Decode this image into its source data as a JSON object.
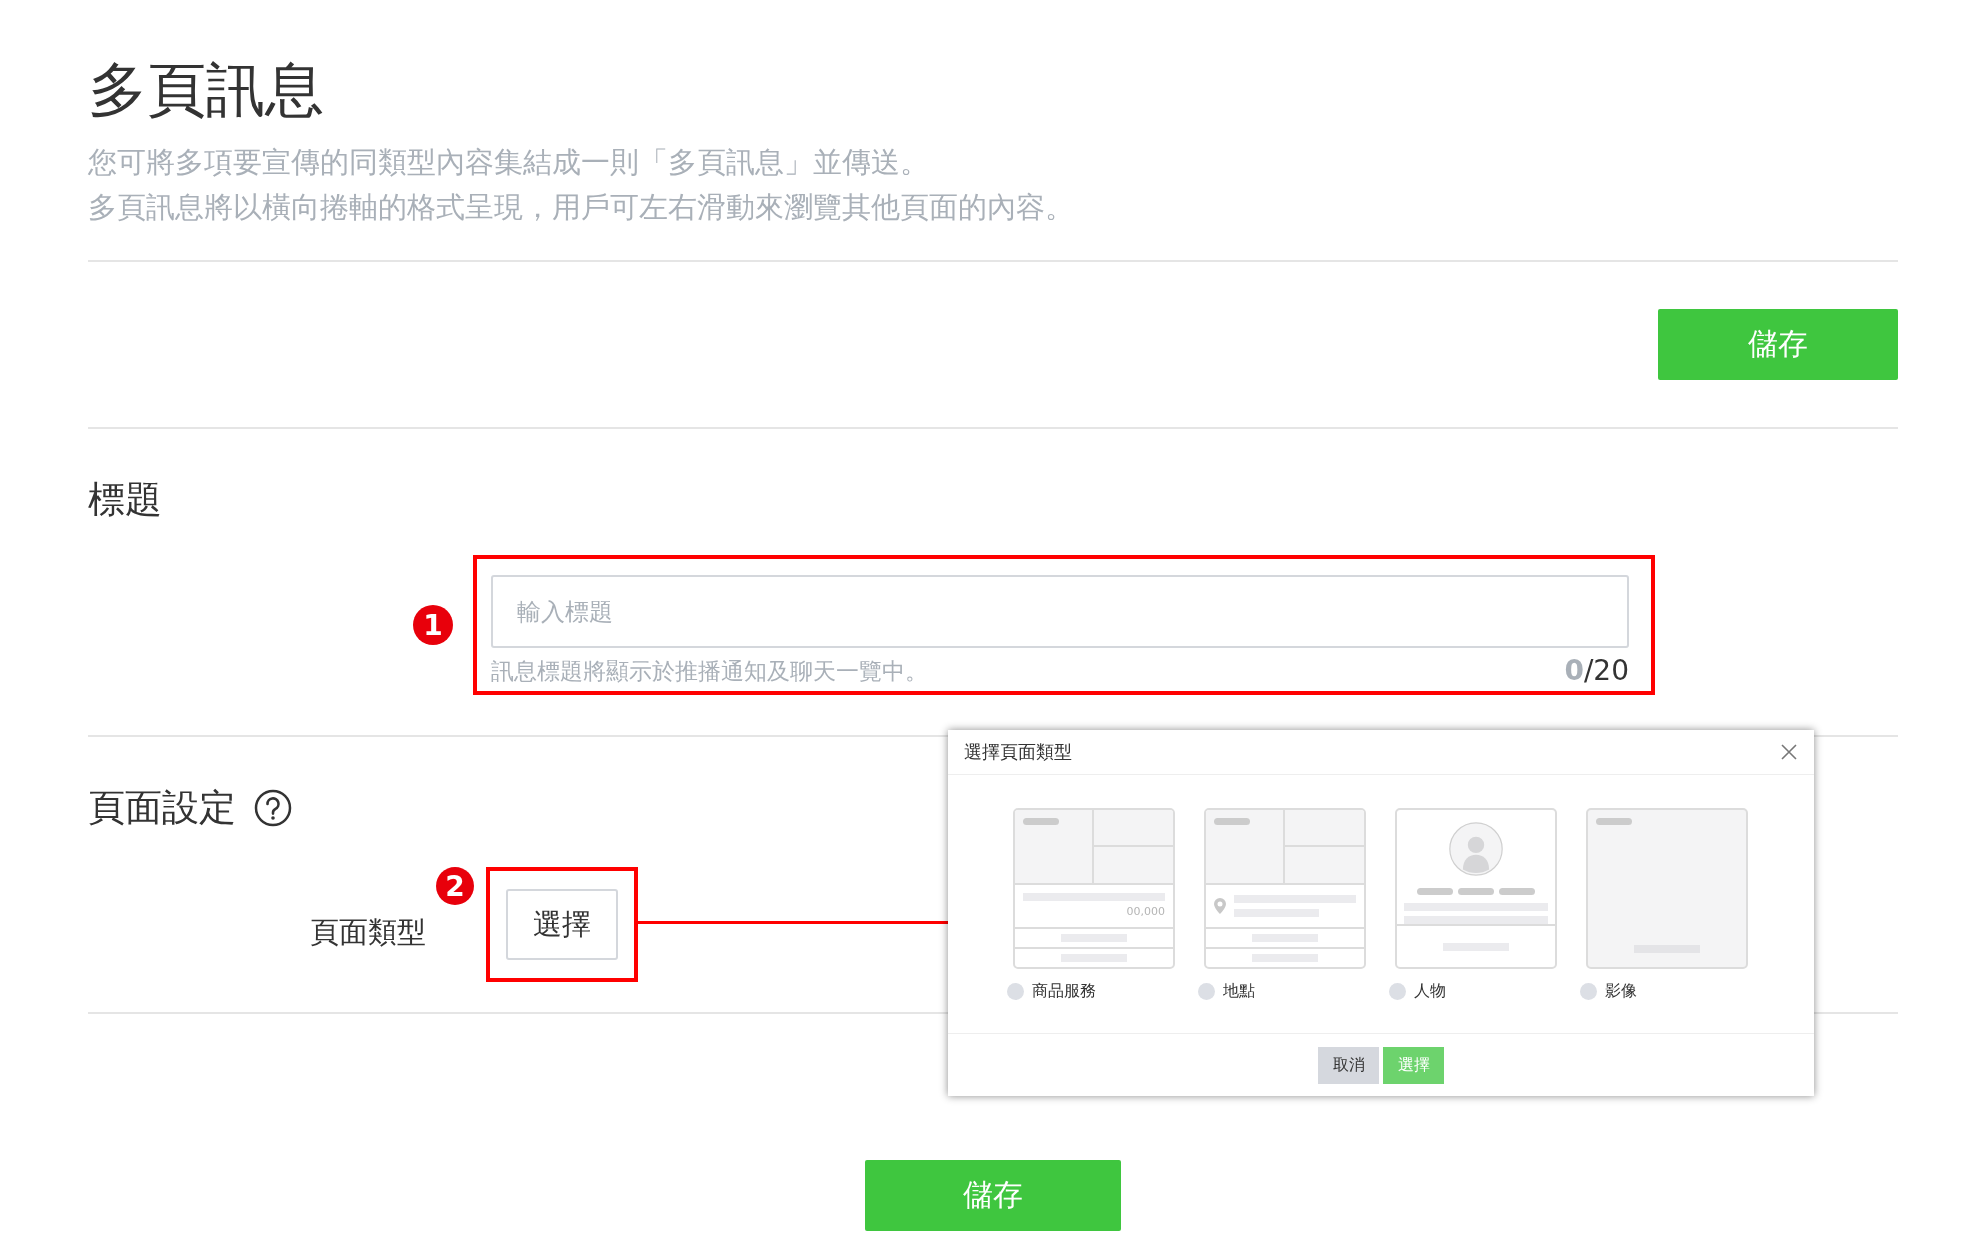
{
  "page": {
    "title": "多頁訊息",
    "description": [
      "您可將多項要宣傳的同類型內容集結成一則「多頁訊息」並傳送。",
      "多頁訊息將以橫向捲軸的格式呈現，用戶可左右滑動來瀏覽其他頁面的內容。"
    ]
  },
  "top_save_button": "儲存",
  "title_section": {
    "heading": "標題",
    "annotation": "1",
    "field": {
      "placeholder": "輸入標題",
      "hint": "訊息標題將顯示於推播通知及聊天一覽中。",
      "counter": "**0**/20"
    }
  },
  "page_settings": {
    "heading": "頁面設定",
    "type_label": "頁面類型",
    "select_button": "選擇",
    "annotation": "2"
  },
  "dialog": {
    "title": "選擇頁面類型",
    "options": [
      {
        "kind": "product",
        "label": "商品服務",
        "price": "00,000",
        "selected": false
      },
      {
        "kind": "location",
        "label": "地點",
        "selected": false
      },
      {
        "kind": "person",
        "label": "人物",
        "selected": false
      },
      {
        "kind": "image",
        "label": "影像",
        "selected": false
      }
    ],
    "buttons": [
      {
        "kind": "cancel",
        "label": "取消"
      },
      {
        "kind": "confirm",
        "label": "選擇"
      }
    ]
  },
  "bottom_save_button": "儲存"
}
